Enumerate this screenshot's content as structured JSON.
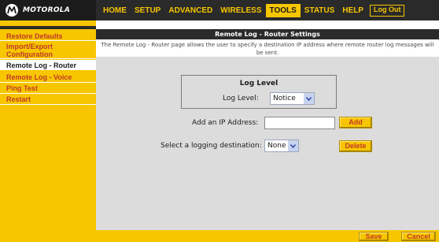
{
  "brand": {
    "name": "MOTOROLA",
    "logo_icon": "motorola-batwing-logo"
  },
  "topnav": {
    "items": [
      {
        "label": "HOME",
        "active": false
      },
      {
        "label": "SETUP",
        "active": false
      },
      {
        "label": "ADVANCED",
        "active": false
      },
      {
        "label": "WIRELESS",
        "active": false
      },
      {
        "label": "TOOLS",
        "active": true
      },
      {
        "label": "STATUS",
        "active": false
      },
      {
        "label": "HELP",
        "active": false
      }
    ],
    "logout_label": "Log Out"
  },
  "sidebar": {
    "items": [
      {
        "label": "Restore Defaults",
        "active": false
      },
      {
        "label": "Import/Export Configuration",
        "active": false
      },
      {
        "label": "Remote Log - Router",
        "active": true
      },
      {
        "label": "Remote Log - Voice",
        "active": false
      },
      {
        "label": "Ping Test",
        "active": false
      },
      {
        "label": "Restart",
        "active": false
      }
    ]
  },
  "page": {
    "title": "Remote Log - Router Settings",
    "description": "The Remote Log - Router page allows the user to specify a destination IP address where remote router log messages will be sent."
  },
  "log_level": {
    "box_title": "Log Level",
    "label": "Log Level:",
    "selected": "Notice"
  },
  "ip": {
    "label": "Add an IP Address:",
    "value": "",
    "add_label": "Add"
  },
  "destination": {
    "label": "Select a logging destination:",
    "selected": "None",
    "delete_label": "Delete"
  },
  "footer": {
    "save_label": "Save",
    "cancel_label": "Cancel"
  },
  "colors": {
    "accent_yellow": "#f7c600",
    "nav_dark": "#2a2a2a",
    "link_red": "#c0392b",
    "content_gray": "#dcdcdc"
  }
}
